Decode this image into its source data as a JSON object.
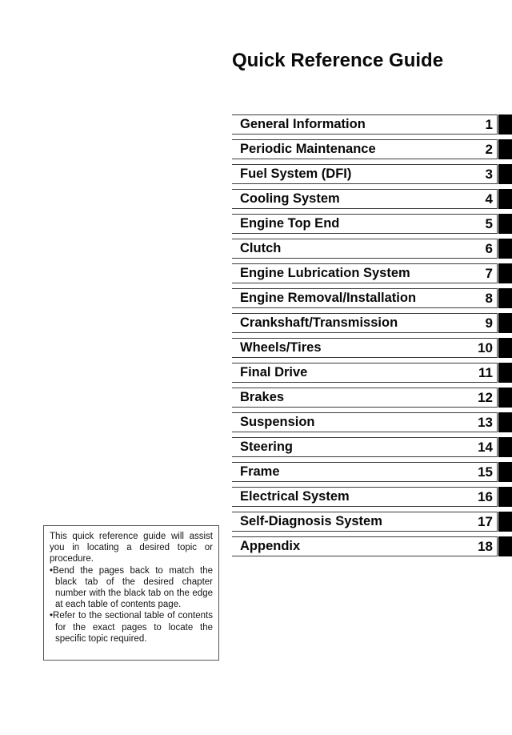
{
  "document": {
    "title": "Quick Reference Guide"
  },
  "index": {
    "rows": [
      {
        "label": "General Information",
        "number": "1"
      },
      {
        "label": "Periodic Maintenance",
        "number": "2"
      },
      {
        "label": "Fuel System (DFI)",
        "number": "3"
      },
      {
        "label": "Cooling System",
        "number": "4"
      },
      {
        "label": "Engine Top End",
        "number": "5"
      },
      {
        "label": "Clutch",
        "number": "6"
      },
      {
        "label": "Engine Lubrication System",
        "number": "7"
      },
      {
        "label": "Engine Removal/Installation",
        "number": "8"
      },
      {
        "label": "Crankshaft/Transmission",
        "number": "9"
      },
      {
        "label": "Wheels/Tires",
        "number": "10"
      },
      {
        "label": "Final Drive",
        "number": "11"
      },
      {
        "label": "Brakes",
        "number": "12"
      },
      {
        "label": "Suspension",
        "number": "13"
      },
      {
        "label": "Steering",
        "number": "14"
      },
      {
        "label": "Frame",
        "number": "15"
      },
      {
        "label": "Electrical System",
        "number": "16"
      },
      {
        "label": "Self-Diagnosis System",
        "number": "17"
      },
      {
        "label": "Appendix",
        "number": "18"
      }
    ]
  },
  "note": {
    "intro": "This quick reference guide will assist you in locating a desired topic or procedure.",
    "bullets": [
      "Bend the pages back to match the black tab of the desired chapter number with the black tab on the edge at each table of contents page.",
      "Refer to the sectional table of contents for the exact pages to locate the specific topic required."
    ],
    "bullet_glyph": "•"
  },
  "colors": {
    "page_background": "#ffffff",
    "ink": "#000000",
    "tab_black": "#000000",
    "rule_gray": "#3b3b3b",
    "note_border": "#555555"
  }
}
